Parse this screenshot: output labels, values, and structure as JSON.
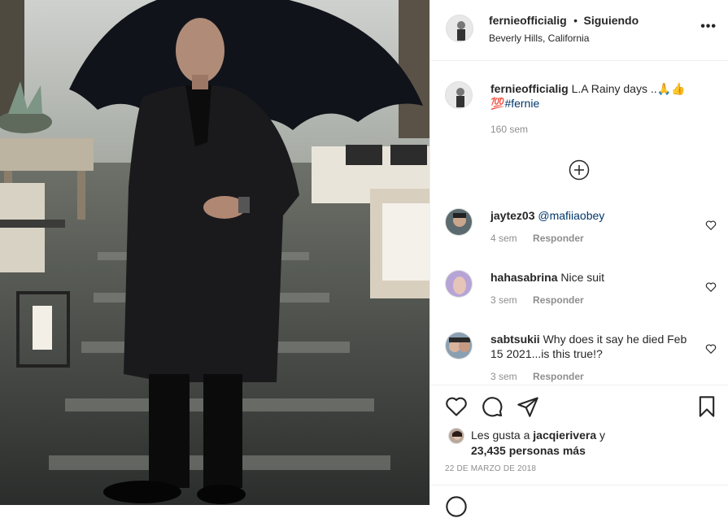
{
  "post": {
    "username": "fernieofficialig",
    "follow_dot": "•",
    "follow_label": "Siguiendo",
    "location": "Beverly Hills, California",
    "more_label": "•••"
  },
  "caption": {
    "username": "fernieofficialig",
    "text": "L.A Rainy days ..",
    "emojis": "🙏👍",
    "emoji_line2": "💯",
    "hashtag": "#fernie",
    "age": "160 sem"
  },
  "comments": [
    {
      "username": "jaytez03",
      "mention": "@mafiiaobey",
      "text": "",
      "age": "4 sem",
      "reply": "Responder"
    },
    {
      "username": "hahasabrina",
      "mention": "",
      "text": "Nice suit",
      "age": "3 sem",
      "reply": "Responder"
    },
    {
      "username": "sabtsukii",
      "mention": "",
      "text": "Why does it say he died Feb 15 2021...is this true!?",
      "age": "3 sem",
      "reply": "Responder"
    }
  ],
  "likes": {
    "prefix": "Les gusta a",
    "user": "jacqierivera",
    "and": "y",
    "count": "23,435 personas más"
  },
  "date": "22 DE MARZO DE 2018",
  "icons": {
    "like": "heart-icon",
    "comment": "comment-bubble-icon",
    "share": "paper-plane-icon",
    "save": "bookmark-icon",
    "more_comments": "plus-circle-icon"
  },
  "colors": {
    "text": "#262626",
    "muted": "#8e8e8e",
    "link": "#00376b",
    "border": "#efefef"
  }
}
